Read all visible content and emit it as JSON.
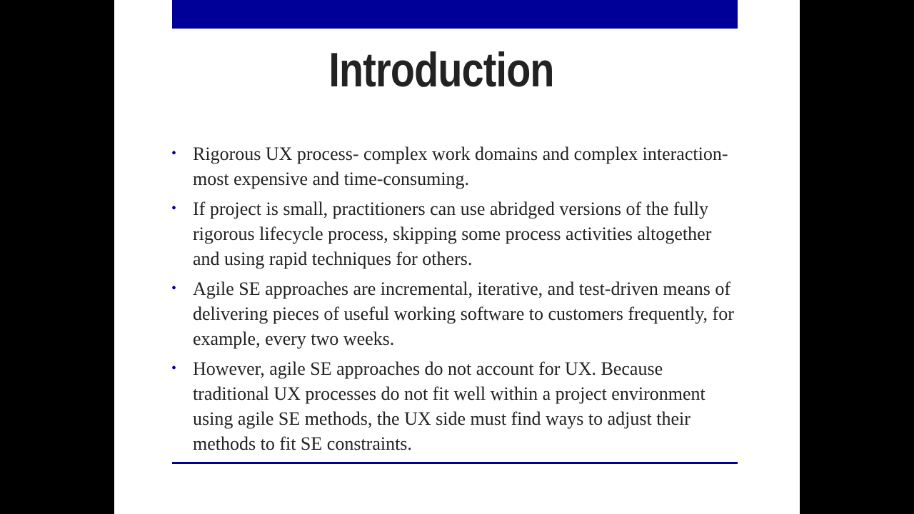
{
  "slide": {
    "title": "Introduction",
    "bullet_marker": "•",
    "bullets": [
      "Rigorous UX process- complex work domains and complex interaction-most expensive and time-consuming.",
      "If project is small, practitioners can use abridged versions of the fully rigorous lifecycle process, skipping some process activities altogether and using rapid techniques for others.",
      "Agile SE approaches are incremental, iterative, and test-driven means of delivering pieces of useful working software to customers frequently, for example, every two weeks.",
      "However, agile SE approaches do not account for UX. Because traditional UX processes do not fit well within a project environment using agile SE methods, the UX side must find ways to adjust their methods to fit SE constraints."
    ]
  },
  "colors": {
    "accent": "#000099",
    "text": "#222222",
    "background": "#ffffff",
    "letterbox": "#000000"
  }
}
